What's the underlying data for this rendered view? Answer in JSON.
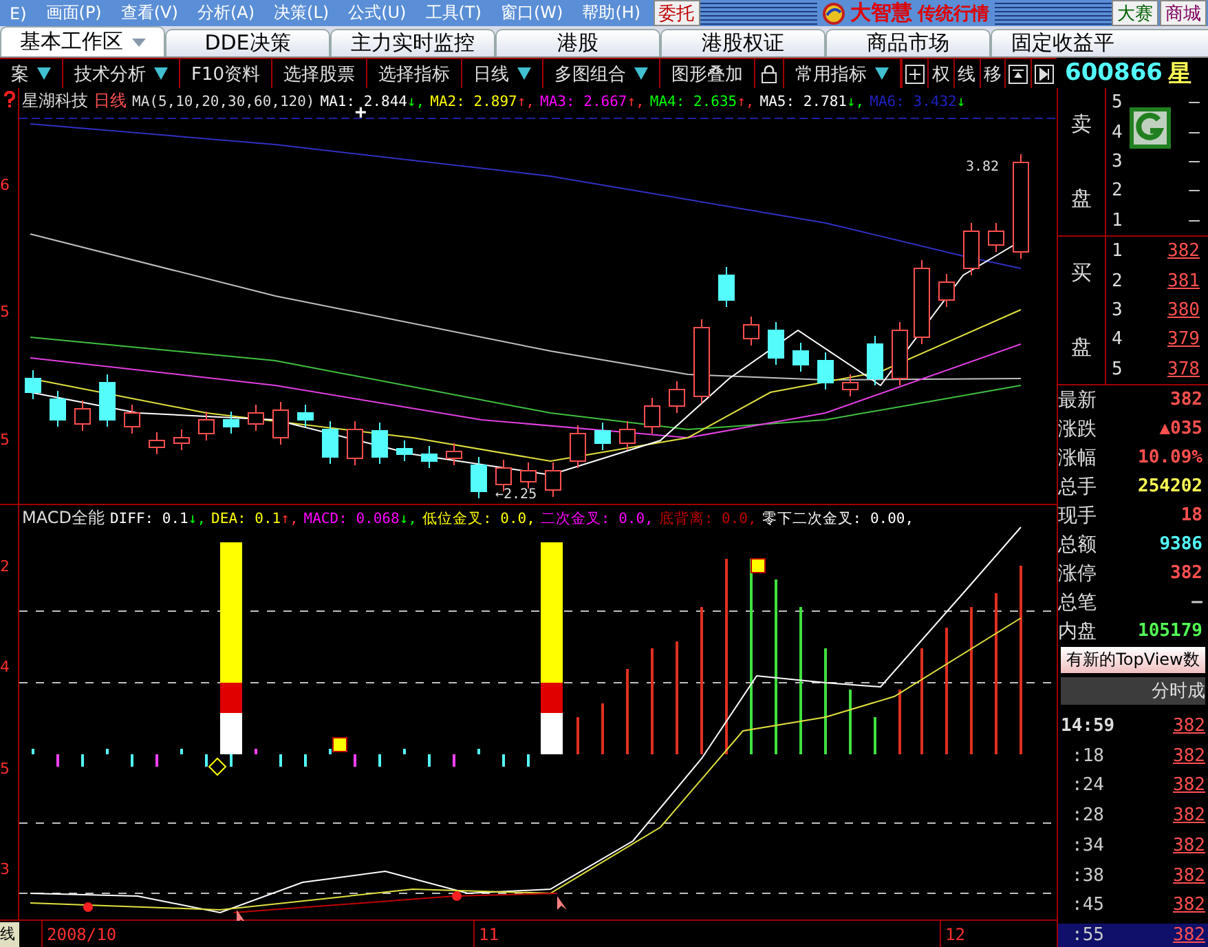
{
  "menu": {
    "items": [
      "E)",
      "画面(P)",
      "查看(V)",
      "分析(A)",
      "决策(L)",
      "公式(U)",
      "工具(T)",
      "窗口(W)",
      "帮助(H)"
    ],
    "order_button": "委托",
    "logo": "大智慧",
    "title": "传统行情",
    "buttons": [
      "大赛",
      "商城"
    ]
  },
  "tabs": [
    {
      "label": "基本工作区",
      "selected": true
    },
    {
      "label": "DDE决策",
      "selected": false
    },
    {
      "label": "主力实时监控",
      "selected": false
    },
    {
      "label": "港股",
      "selected": false
    },
    {
      "label": "港股权证",
      "selected": false
    },
    {
      "label": "商品市场",
      "selected": false
    },
    {
      "label": "固定收益平",
      "selected": false
    }
  ],
  "toolbar": {
    "items": [
      {
        "label": "案",
        "dropdown": true
      },
      {
        "label": "技术分析",
        "dropdown": true
      },
      {
        "label": "F10资料",
        "dropdown": false
      },
      {
        "label": "选择股票",
        "dropdown": false
      },
      {
        "label": "选择指标",
        "dropdown": false
      },
      {
        "label": "日线",
        "dropdown": true
      },
      {
        "label": "多图组合",
        "dropdown": true
      },
      {
        "label": "图形叠加",
        "dropdown": false
      }
    ],
    "extra": [
      {
        "label": "常用指标",
        "dropdown": true
      }
    ],
    "tools": [
      {
        "kind": "plus"
      },
      {
        "kind": "label",
        "label": "权"
      },
      {
        "kind": "label",
        "label": "线"
      },
      {
        "kind": "label",
        "label": "移"
      },
      {
        "kind": "panel"
      },
      {
        "kind": "step"
      }
    ]
  },
  "stock": {
    "code": "600866",
    "name": "星"
  },
  "kline": {
    "name": "星湖科技",
    "period": "日线",
    "params": "MA(5,10,20,30,60,120)",
    "mas": [
      {
        "text": "MA1: 2.844",
        "arrow": {
          "text": "↓,",
          "color": "#00ff00"
        },
        "color": "#ffffff"
      },
      {
        "text": "MA2: 2.897",
        "arrow": {
          "text": "↑,",
          "color": "#ff3030"
        },
        "color": "#ffff00"
      },
      {
        "text": "MA3: 2.667",
        "arrow": {
          "text": "↑,",
          "color": "#ff3030"
        },
        "color": "#ff00ff"
      },
      {
        "text": "MA4: 2.635",
        "arrow": {
          "text": "↑,",
          "color": "#ff3030"
        },
        "color": "#00ff00"
      },
      {
        "text": "MA5: 2.781",
        "arrow": {
          "text": "↓,",
          "color": "#00ff00"
        },
        "color": "#ffffff"
      },
      {
        "text": "MA6: 3.432",
        "arrow": {
          "text": "↓",
          "color": "#00ff00"
        },
        "color": "#2020c0"
      }
    ],
    "axis": [
      "6",
      "5",
      "5"
    ],
    "high": "3.82",
    "low": "←2.25",
    "cursor": "+"
  },
  "macd": {
    "title": "MACD全能",
    "axis": [
      "2",
      "4",
      "5",
      "3"
    ],
    "items": [
      {
        "text": "DIFF: 0.1",
        "arrow": {
          "text": "↓,",
          "color": "#00ff00"
        },
        "color": "#ffffff"
      },
      {
        "text": "DEA: 0.1",
        "arrow": {
          "text": "↑,",
          "color": "#ff3030"
        },
        "color": "#ffff00"
      },
      {
        "text": "MACD: 0.068",
        "arrow": {
          "text": "↓,",
          "color": "#00ff00"
        },
        "color": "#ff00ff"
      },
      {
        "text": "低位金叉: 0.0,",
        "color": "#ffff00"
      },
      {
        "text": "二次金叉: 0.0,",
        "color": "#ff00ff"
      },
      {
        "text": "底背离: 0.0,",
        "color": "#c00000"
      },
      {
        "text": "零下二次金叉: 0.00,",
        "color": "#ffffff"
      }
    ]
  },
  "dates": {
    "mode": "线",
    "labels": [
      "2008/10",
      "11",
      "12"
    ]
  },
  "quote": {
    "sell_label": [
      "卖",
      "盘"
    ],
    "sell": [
      {
        "level": "5",
        "price": "—"
      },
      {
        "level": "4",
        "price": "—"
      },
      {
        "level": "3",
        "price": "—"
      },
      {
        "level": "2",
        "price": "—"
      },
      {
        "level": "1",
        "price": "—"
      }
    ],
    "buy_label": [
      "买",
      "盘"
    ],
    "buy": [
      {
        "level": "1",
        "price": "382"
      },
      {
        "level": "2",
        "price": "381"
      },
      {
        "level": "3",
        "price": "380"
      },
      {
        "level": "4",
        "price": "379"
      },
      {
        "level": "5",
        "price": "378"
      }
    ],
    "stats": [
      {
        "label": "最新",
        "value": "382",
        "color": "#ff5050"
      },
      {
        "label": "涨跌",
        "value": "▲035",
        "color": "#ff5050"
      },
      {
        "label": "涨幅",
        "value": "10.09%",
        "color": "#ff5050"
      },
      {
        "label": "总手",
        "value": "254202",
        "color": "#ffff54"
      },
      {
        "label": "现手",
        "value": "18",
        "color": "#ff5050"
      },
      {
        "label": "总额",
        "value": "9386",
        "color": "#54fcfc"
      },
      {
        "label": "涨停",
        "value": "382",
        "color": "#ff5050"
      },
      {
        "label": "总笔",
        "value": "—",
        "color": "#c0c0c0"
      },
      {
        "label": "内盘",
        "value": "105179",
        "color": "#54fc54"
      }
    ],
    "banner": "有新的TopView数",
    "ticks_title": "分时成",
    "ticks": [
      {
        "time": "14:59",
        "price": "382",
        "selected": false
      },
      {
        "time": ":18",
        "price": "382",
        "selected": false
      },
      {
        "time": ":24",
        "price": "382",
        "selected": false
      },
      {
        "time": ":28",
        "price": "382",
        "selected": false
      },
      {
        "time": ":34",
        "price": "382",
        "selected": false
      },
      {
        "time": ":38",
        "price": "382",
        "selected": false
      },
      {
        "time": ":45",
        "price": "382",
        "selected": false
      },
      {
        "time": ":55",
        "price": "382",
        "selected": true
      }
    ]
  }
}
